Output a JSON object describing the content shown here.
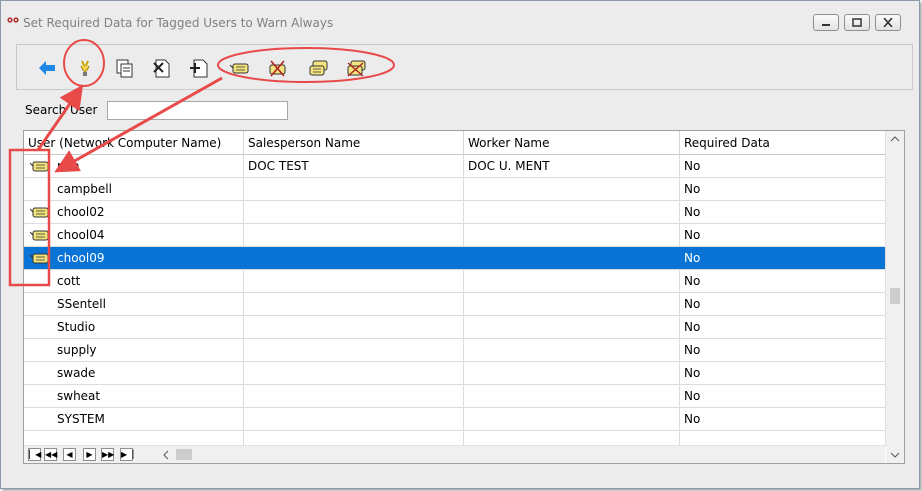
{
  "window": {
    "title": "Set Required Data for Tagged Users to Warn Always"
  },
  "toolbar": {
    "buttons": [
      {
        "name": "back-button",
        "icon": "back-arrow-icon"
      },
      {
        "name": "tag-toggle-button",
        "icon": "bulb-icon"
      },
      {
        "name": "copy-button",
        "icon": "copy-icon"
      },
      {
        "name": "delete-button",
        "icon": "delete-document-icon"
      },
      {
        "name": "add-button",
        "icon": "add-document-icon"
      },
      {
        "name": "tag-button",
        "icon": "tag-icon"
      },
      {
        "name": "untag-button",
        "icon": "untag-icon"
      },
      {
        "name": "tag-all-button",
        "icon": "tag-all-icon"
      },
      {
        "name": "untag-all-button",
        "icon": "untag-all-icon"
      }
    ]
  },
  "search": {
    "label": "Search User",
    "value": ""
  },
  "grid": {
    "columns": [
      "User (Network Computer Name)",
      "Salesperson Name",
      "Worker Name",
      "Required Data"
    ],
    "rows": [
      {
        "tagged": true,
        "user": "nna",
        "salesperson": "DOC TEST",
        "worker": "DOC U. MENT",
        "required": "No",
        "selected": false
      },
      {
        "tagged": false,
        "user": "campbell",
        "salesperson": "",
        "worker": "",
        "required": "No",
        "selected": false
      },
      {
        "tagged": true,
        "user": "chool02",
        "salesperson": "",
        "worker": "",
        "required": "No",
        "selected": false
      },
      {
        "tagged": true,
        "user": "chool04",
        "salesperson": "",
        "worker": "",
        "required": "No",
        "selected": false
      },
      {
        "tagged": true,
        "user": "chool09",
        "salesperson": "",
        "worker": "",
        "required": "No",
        "selected": true
      },
      {
        "tagged": false,
        "user": "cott",
        "salesperson": "",
        "worker": "",
        "required": "No",
        "selected": false
      },
      {
        "tagged": false,
        "user": "SSentell",
        "salesperson": "",
        "worker": "",
        "required": "No",
        "selected": false
      },
      {
        "tagged": false,
        "user": "Studio",
        "salesperson": "",
        "worker": "",
        "required": "No",
        "selected": false
      },
      {
        "tagged": false,
        "user": "supply",
        "salesperson": "",
        "worker": "",
        "required": "No",
        "selected": false
      },
      {
        "tagged": false,
        "user": "swade",
        "salesperson": "",
        "worker": "",
        "required": "No",
        "selected": false
      },
      {
        "tagged": false,
        "user": "swheat",
        "salesperson": "",
        "worker": "",
        "required": "No",
        "selected": false
      },
      {
        "tagged": false,
        "user": "SYSTEM",
        "salesperson": "",
        "worker": "",
        "required": "No",
        "selected": false
      },
      {
        "tagged": false,
        "user": "",
        "salesperson": "",
        "worker": "",
        "required": "",
        "selected": false
      }
    ]
  },
  "navigator": {
    "buttons": [
      "first-record",
      "previous-page",
      "previous-record",
      "next-record",
      "next-page",
      "last-record"
    ]
  },
  "colors": {
    "selection": "#0a74d6",
    "annotation": "#e84a4a",
    "back_arrow": "#1e88e5"
  }
}
